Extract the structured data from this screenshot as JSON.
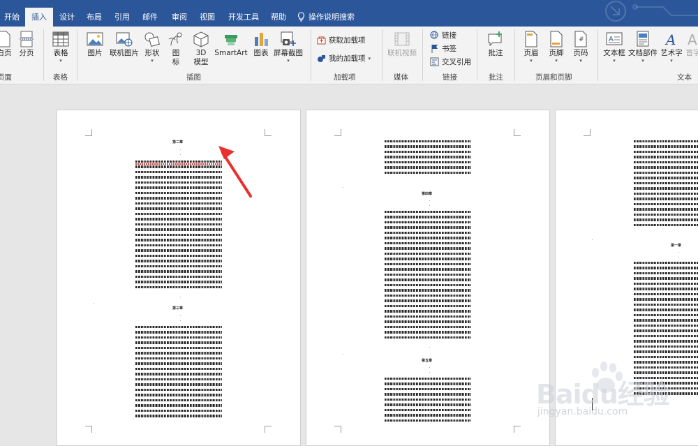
{
  "tabs": [
    "开始",
    "插入",
    "设计",
    "布局",
    "引用",
    "邮件",
    "审阅",
    "视图",
    "开发工具",
    "帮助",
    "操作说明搜索"
  ],
  "active_tab": "插入",
  "ribbon": {
    "pages_group": {
      "buttons": [
        "白页",
        "分页"
      ],
      "group_name": "页面"
    },
    "table_group": {
      "buttons": [
        "表格"
      ],
      "group_name": "表格"
    },
    "illustrations_group": {
      "buttons": [
        "图片",
        "联机图片",
        "形状",
        "图标",
        "3D 模型",
        "SmartArt",
        "图表",
        "屏幕截图"
      ],
      "icon_lbl": [
        "图",
        "标"
      ],
      "model_lbl": [
        "3D",
        "模型"
      ],
      "group_name": "插图"
    },
    "addins_group": {
      "buttons": [
        "获取加载项",
        "我的加载项"
      ],
      "group_name": "加载项"
    },
    "media_group": {
      "buttons": [
        "联机视频"
      ],
      "group_name": "媒体"
    },
    "links_group": {
      "buttons": [
        "链接",
        "书签",
        "交叉引用"
      ],
      "group_name": "链接"
    },
    "comments_group": {
      "buttons": [
        "批注"
      ],
      "group_name": "批注"
    },
    "header_footer_group": {
      "buttons": [
        "页眉",
        "页脚",
        "页码"
      ],
      "group_name": "页眉和页脚"
    },
    "text_group": {
      "buttons": [
        "文本框",
        "文档部件",
        "艺术字",
        "首字"
      ],
      "group_name": "文本"
    }
  },
  "pages": [
    {
      "headings": [
        "第二章",
        "第三章"
      ]
    },
    {
      "headings": [
        "第四章",
        "第五章"
      ]
    },
    {
      "headings": [
        "第一章"
      ]
    }
  ],
  "watermark": {
    "brand": "Baidu经验",
    "url": "jingyan.baidu.com"
  },
  "colors": {
    "ribbon_blue": "#2b579a",
    "arrow": "#e8312f",
    "spellcheck": "#e8312f"
  }
}
